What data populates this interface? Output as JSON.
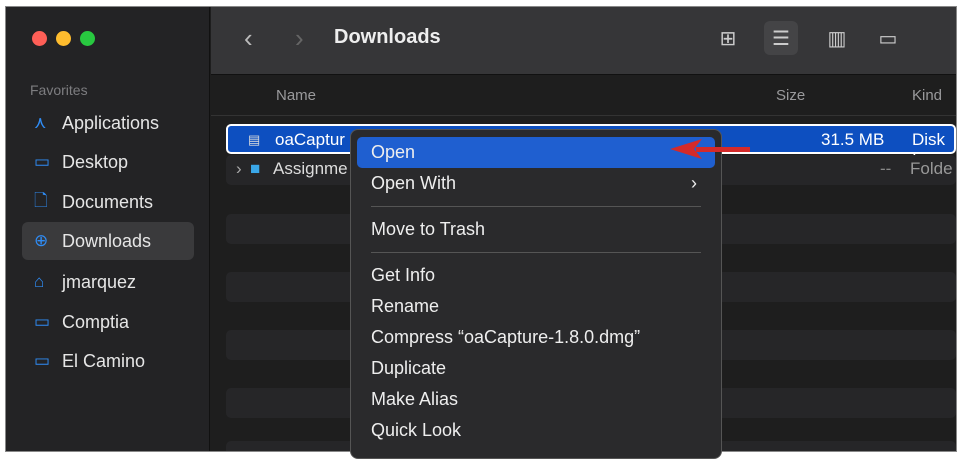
{
  "window": {
    "title": "Downloads"
  },
  "sidebar": {
    "section": "Favorites",
    "items": [
      {
        "label": "Applications",
        "icon": "apps-icon",
        "glyph": "⋏"
      },
      {
        "label": "Desktop",
        "icon": "desktop-icon",
        "glyph": "▭"
      },
      {
        "label": "Documents",
        "icon": "document-icon",
        "glyph": "🗋"
      },
      {
        "label": "Downloads",
        "icon": "download-icon",
        "glyph": "⊕"
      },
      {
        "label": "jmarquez",
        "icon": "home-icon",
        "glyph": "⌂"
      },
      {
        "label": "Comptia",
        "icon": "folder-icon",
        "glyph": "▭"
      },
      {
        "label": "El Camino",
        "icon": "folder-icon",
        "glyph": "▭"
      }
    ]
  },
  "columns": {
    "name": "Name",
    "size": "Size",
    "kind": "Kind"
  },
  "files": [
    {
      "name": "oaCaptur",
      "size": "31.5 MB",
      "kind": "Disk I"
    },
    {
      "name": "Assignme",
      "size": "--",
      "kind": "Folde"
    }
  ],
  "context_menu": {
    "items": [
      "Open",
      "Open With",
      "Move to Trash",
      "Get Info",
      "Rename",
      "Compress “oaCapture-1.8.0.dmg”",
      "Duplicate",
      "Make Alias",
      "Quick Look"
    ]
  },
  "colors": {
    "accent": "#0d4fc0",
    "arrow": "#d42a2a"
  }
}
